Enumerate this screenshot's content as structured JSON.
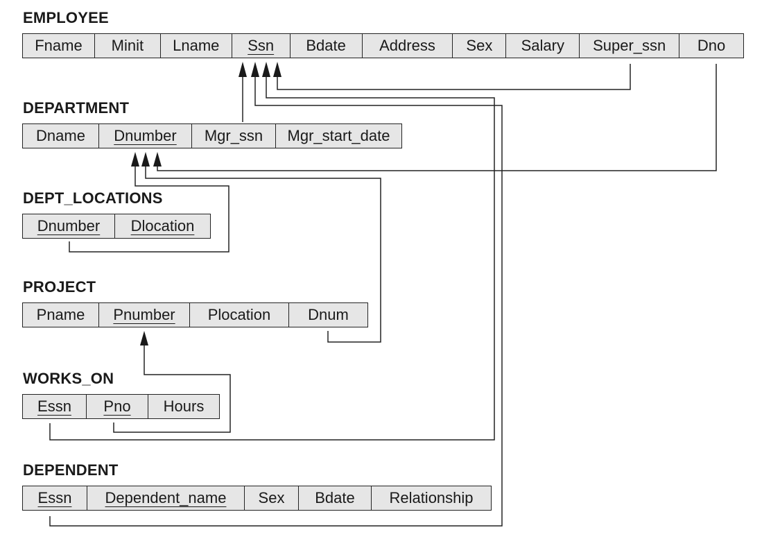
{
  "relations": [
    {
      "name": "EMPLOYEE",
      "attributes": [
        {
          "label": "Fname",
          "pk": false
        },
        {
          "label": "Minit",
          "pk": false
        },
        {
          "label": "Lname",
          "pk": false
        },
        {
          "label": "Ssn",
          "pk": true
        },
        {
          "label": "Bdate",
          "pk": false
        },
        {
          "label": "Address",
          "pk": false
        },
        {
          "label": "Sex",
          "pk": false
        },
        {
          "label": "Salary",
          "pk": false
        },
        {
          "label": "Super_ssn",
          "pk": false
        },
        {
          "label": "Dno",
          "pk": false
        }
      ]
    },
    {
      "name": "DEPARTMENT",
      "attributes": [
        {
          "label": "Dname",
          "pk": false
        },
        {
          "label": "Dnumber",
          "pk": true
        },
        {
          "label": "Mgr_ssn",
          "pk": false
        },
        {
          "label": "Mgr_start_date",
          "pk": false
        }
      ]
    },
    {
      "name": "DEPT_LOCATIONS",
      "attributes": [
        {
          "label": "Dnumber",
          "pk": true
        },
        {
          "label": "Dlocation",
          "pk": true
        }
      ]
    },
    {
      "name": "PROJECT",
      "attributes": [
        {
          "label": "Pname",
          "pk": false
        },
        {
          "label": "Pnumber",
          "pk": true
        },
        {
          "label": "Plocation",
          "pk": false
        },
        {
          "label": "Dnum",
          "pk": false
        }
      ]
    },
    {
      "name": "WORKS_ON",
      "attributes": [
        {
          "label": "Essn",
          "pk": true
        },
        {
          "label": "Pno",
          "pk": true
        },
        {
          "label": "Hours",
          "pk": false
        }
      ]
    },
    {
      "name": "DEPENDENT",
      "attributes": [
        {
          "label": "Essn",
          "pk": true
        },
        {
          "label": "Dependent_name",
          "pk": true
        },
        {
          "label": "Sex",
          "pk": false
        },
        {
          "label": "Bdate",
          "pk": false
        },
        {
          "label": "Relationship",
          "pk": false
        }
      ]
    }
  ],
  "foreign_keys": [
    {
      "from": "EMPLOYEE.Super_ssn",
      "to": "EMPLOYEE.Ssn"
    },
    {
      "from": "EMPLOYEE.Dno",
      "to": "DEPARTMENT.Dnumber"
    },
    {
      "from": "DEPARTMENT.Mgr_ssn",
      "to": "EMPLOYEE.Ssn"
    },
    {
      "from": "DEPT_LOCATIONS.Dnumber",
      "to": "DEPARTMENT.Dnumber"
    },
    {
      "from": "PROJECT.Dnum",
      "to": "DEPARTMENT.Dnumber"
    },
    {
      "from": "WORKS_ON.Essn",
      "to": "EMPLOYEE.Ssn"
    },
    {
      "from": "WORKS_ON.Pno",
      "to": "PROJECT.Pnumber"
    },
    {
      "from": "DEPENDENT.Essn",
      "to": "EMPLOYEE.Ssn"
    }
  ],
  "colors": {
    "cell_fill": "#e6e6e6",
    "line": "#222222"
  }
}
